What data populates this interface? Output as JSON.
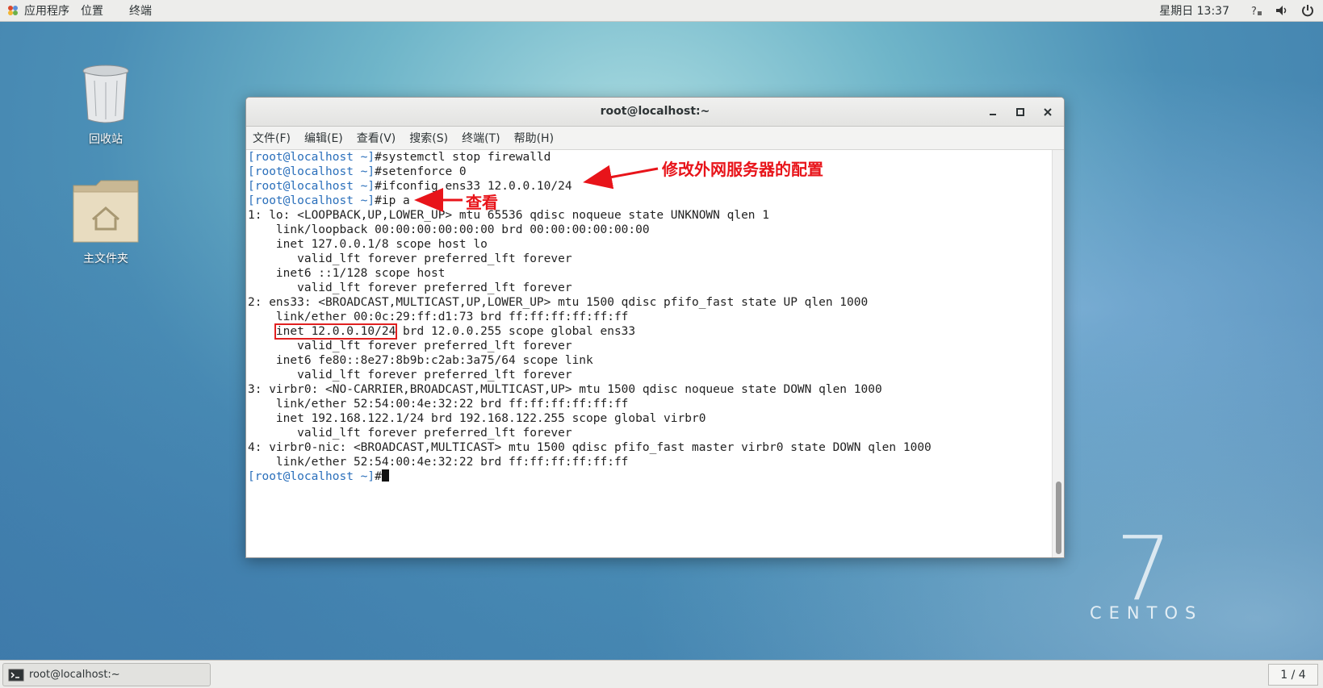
{
  "top_panel": {
    "applications": "应用程序",
    "places": "位置",
    "terminal": "终端",
    "clock": "星期日 13:37"
  },
  "desktop": {
    "trash_label": "回收站",
    "home_label": "主文件夹",
    "centos_number": "7",
    "centos_text": "CENTOS"
  },
  "window": {
    "title": "root@localhost:~",
    "menu": [
      "文件(F)",
      "编辑(E)",
      "查看(V)",
      "搜索(S)",
      "终端(T)",
      "帮助(H)"
    ]
  },
  "terminal": {
    "prompt": "[root@localhost ~]",
    "lines": [
      {
        "type": "cmd",
        "text": "#systemctl stop firewalld"
      },
      {
        "type": "cmd",
        "text": "#setenforce 0"
      },
      {
        "type": "cmd",
        "text": "#ifconfig ens33 12.0.0.10/24"
      },
      {
        "type": "cmd",
        "text": "#ip a"
      },
      {
        "type": "out",
        "text": "1: lo: <LOOPBACK,UP,LOWER_UP> mtu 65536 qdisc noqueue state UNKNOWN qlen 1"
      },
      {
        "type": "out",
        "text": "    link/loopback 00:00:00:00:00:00 brd 00:00:00:00:00:00"
      },
      {
        "type": "out",
        "text": "    inet 127.0.0.1/8 scope host lo"
      },
      {
        "type": "out",
        "text": "       valid_lft forever preferred_lft forever"
      },
      {
        "type": "out",
        "text": "    inet6 ::1/128 scope host"
      },
      {
        "type": "out",
        "text": "       valid_lft forever preferred_lft forever"
      },
      {
        "type": "out",
        "text": "2: ens33: <BROADCAST,MULTICAST,UP,LOWER_UP> mtu 1500 qdisc pfifo_fast state UP qlen 1000"
      },
      {
        "type": "out",
        "text": "    link/ether 00:0c:29:ff:d1:73 brd ff:ff:ff:ff:ff:ff"
      },
      {
        "type": "hl",
        "pre": "    ",
        "highlight": "inet 12.0.0.10/24",
        "post": " brd 12.0.0.255 scope global ens33"
      },
      {
        "type": "out",
        "text": "       valid_lft forever preferred_lft forever"
      },
      {
        "type": "out",
        "text": "    inet6 fe80::8e27:8b9b:c2ab:3a75/64 scope link"
      },
      {
        "type": "out",
        "text": "       valid_lft forever preferred_lft forever"
      },
      {
        "type": "out",
        "text": "3: virbr0: <NO-CARRIER,BROADCAST,MULTICAST,UP> mtu 1500 qdisc noqueue state DOWN qlen 1000"
      },
      {
        "type": "out",
        "text": "    link/ether 52:54:00:4e:32:22 brd ff:ff:ff:ff:ff:ff"
      },
      {
        "type": "out",
        "text": "    inet 192.168.122.1/24 brd 192.168.122.255 scope global virbr0"
      },
      {
        "type": "out",
        "text": "       valid_lft forever preferred_lft forever"
      },
      {
        "type": "out",
        "text": "4: virbr0-nic: <BROADCAST,MULTICAST> mtu 1500 qdisc pfifo_fast master virbr0 state DOWN qlen 1000"
      },
      {
        "type": "out",
        "text": "    link/ether 52:54:00:4e:32:22 brd ff:ff:ff:ff:ff:ff"
      },
      {
        "type": "cmd",
        "text": "#"
      }
    ]
  },
  "annotations": {
    "config_note": "修改外网服务器的配置",
    "view_note": "查看",
    "color": "#e8141a"
  },
  "taskbar": {
    "task_label": "root@localhost:~",
    "pager": "1 / 4"
  }
}
